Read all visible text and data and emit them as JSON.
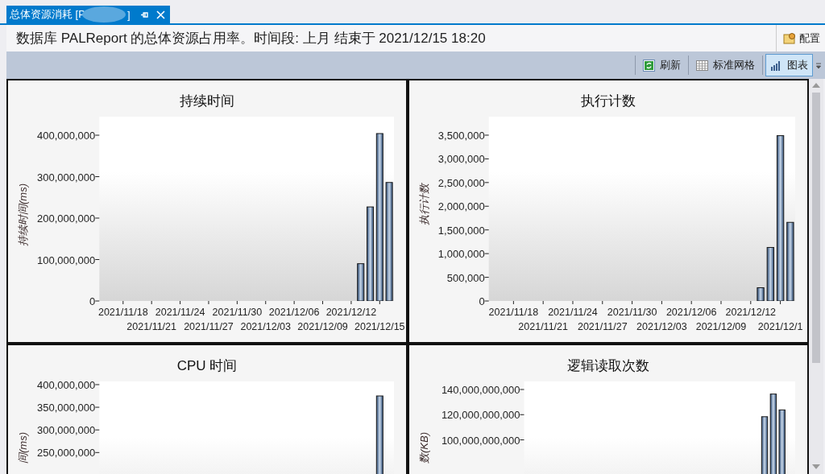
{
  "tab": {
    "title": "总体资源消耗 [P",
    "title_end": "]",
    "pinned": true
  },
  "header": {
    "text": "数据库 PALReport 的总体资源占用率。时间段: 上月 结束于 2021/12/15 18:20",
    "config_button": "配置"
  },
  "toolbar": [
    {
      "label": "刷新",
      "kind": "refresh",
      "selected": false
    },
    {
      "label": "标准网格",
      "kind": "grid",
      "selected": false
    },
    {
      "label": "图表",
      "kind": "chart",
      "selected": true
    }
  ],
  "charts": [
    {
      "chart_data": {
        "type": "bar",
        "title": "持续时间",
        "ylabel": "持续时间(ms)",
        "categories": [
          null,
          null,
          "2021/11/18",
          null,
          null,
          "2021/11/21",
          null,
          null,
          "2021/11/24",
          null,
          null,
          "2021/11/27",
          null,
          null,
          "2021/11/30",
          null,
          null,
          "2021/12/03",
          null,
          null,
          "2021/12/06",
          null,
          null,
          "2021/12/09",
          null,
          null,
          "2021/12/12",
          null,
          null,
          "2021/12/15",
          null
        ],
        "values": [
          null,
          null,
          null,
          null,
          null,
          null,
          null,
          null,
          null,
          null,
          null,
          null,
          null,
          null,
          null,
          null,
          null,
          null,
          null,
          null,
          null,
          null,
          null,
          null,
          null,
          null,
          null,
          90000000,
          227000000,
          404000000,
          286000000
        ],
        "ylim": [
          0,
          444700000
        ],
        "yticks": [
          {
            "value": 0,
            "label": "0"
          },
          {
            "value": 100000000,
            "label": "100,000,000"
          },
          {
            "value": 200000000,
            "label": "200,000,000"
          },
          {
            "value": 300000000,
            "label": "300,000,000"
          },
          {
            "value": 400000000,
            "label": "400,000,000"
          }
        ]
      }
    },
    {
      "chart_data": {
        "type": "bar",
        "title": "执行计数",
        "ylabel": "执行计数",
        "categories": [
          null,
          null,
          "2021/11/18",
          null,
          null,
          "2021/11/21",
          null,
          null,
          "2021/11/24",
          null,
          null,
          "2021/11/27",
          null,
          null,
          "2021/11/30",
          null,
          null,
          "2021/12/03",
          null,
          null,
          "2021/12/06",
          null,
          null,
          "2021/12/09",
          null,
          null,
          "2021/12/12",
          null,
          null,
          "2021/12/1",
          null
        ],
        "values": [
          null,
          null,
          null,
          null,
          null,
          null,
          null,
          null,
          null,
          null,
          null,
          null,
          null,
          null,
          null,
          null,
          null,
          null,
          null,
          null,
          null,
          null,
          null,
          null,
          null,
          null,
          null,
          280000,
          1130000,
          3490000,
          1660000
        ],
        "ylim": [
          0,
          3890000
        ],
        "yticks": [
          {
            "value": 0,
            "label": "0"
          },
          {
            "value": 500000,
            "label": "500,000"
          },
          {
            "value": 1000000,
            "label": "1,000,000"
          },
          {
            "value": 1500000,
            "label": "1,500,000"
          },
          {
            "value": 2000000,
            "label": "2,000,000"
          },
          {
            "value": 2500000,
            "label": "2,500,000"
          },
          {
            "value": 3000000,
            "label": "3,000,000"
          },
          {
            "value": 3500000,
            "label": "3,500,000"
          }
        ]
      }
    },
    {
      "chart_data": {
        "type": "bar",
        "title": "CPU 时间",
        "ylabel": "间(ms)",
        "categories": [
          null,
          null,
          null,
          null,
          null,
          null,
          null,
          null,
          null,
          null,
          null,
          null,
          null,
          null,
          null,
          null,
          null,
          null,
          null,
          null,
          null,
          null,
          null,
          null,
          null,
          null,
          null,
          null,
          null,
          null,
          null
        ],
        "values": [
          null,
          null,
          null,
          null,
          null,
          null,
          null,
          null,
          null,
          null,
          null,
          null,
          null,
          null,
          null,
          null,
          null,
          null,
          null,
          null,
          null,
          null,
          null,
          null,
          null,
          null,
          null,
          null,
          null,
          375000000,
          null
        ],
        "ylim": [
          0,
          407000000
        ],
        "yticks": [
          {
            "value": 250000000,
            "label": "250,000,000"
          },
          {
            "value": 300000000,
            "label": "300,000,000"
          },
          {
            "value": 350000000,
            "label": "350,000,000"
          },
          {
            "value": 400000000,
            "label": "400,000,000"
          }
        ]
      }
    },
    {
      "chart_data": {
        "type": "bar",
        "title": "逻辑读取次数",
        "ylabel": "数(KB)",
        "categories": [
          null,
          null,
          null,
          null,
          null,
          null,
          null,
          null,
          null,
          null,
          null,
          null,
          null,
          null,
          null,
          null,
          null,
          null,
          null,
          null,
          null,
          null,
          null,
          null,
          null,
          null,
          null,
          null,
          null,
          null,
          null
        ],
        "values": [
          null,
          null,
          null,
          null,
          null,
          null,
          null,
          null,
          null,
          null,
          null,
          null,
          null,
          null,
          null,
          null,
          null,
          null,
          null,
          null,
          null,
          null,
          null,
          null,
          null,
          null,
          null,
          118400000000,
          136400000000,
          123800000000,
          null
        ],
        "ylim": [
          0,
          146400000000
        ],
        "yticks": [
          {
            "value": 100000000000,
            "label": "100,000,000,000"
          },
          {
            "value": 120000000000,
            "label": "120,000,000,000"
          },
          {
            "value": 140000000000,
            "label": "140,000,000,000"
          }
        ]
      }
    }
  ]
}
